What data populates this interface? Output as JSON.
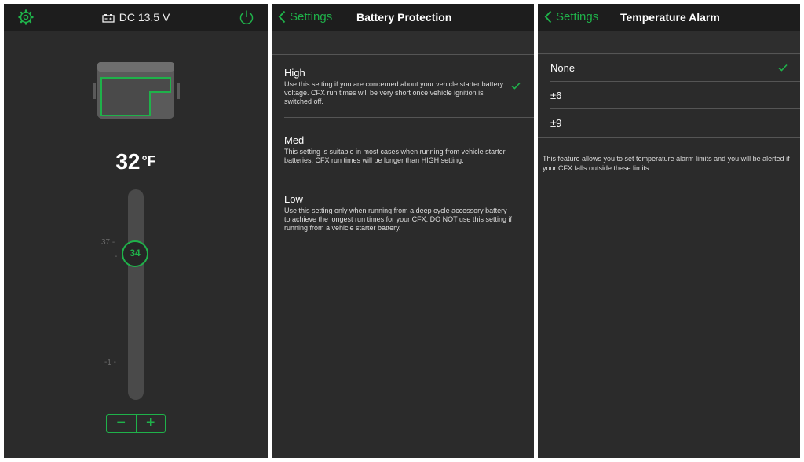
{
  "colors": {
    "accent": "#1fb24a",
    "panel_bg": "#2b2b2b",
    "bar_bg": "#1d1d1d"
  },
  "main": {
    "status": "DC 13.5 V",
    "temperature": "32",
    "unit": "°F",
    "setpoint": "34",
    "scale_top": "37",
    "scale_bottom": "-1",
    "minus": "−",
    "plus": "+"
  },
  "battery": {
    "back": "Settings",
    "title": "Battery Protection",
    "options": [
      {
        "name": "High",
        "desc": "Use this setting if you are concerned about your vehicle starter battery voltage. CFX run times will be very short once vehicle ignition is switched off."
      },
      {
        "name": "Med",
        "desc": "This setting is suitable in most cases when running from vehicle starter batteries. CFX run times will be longer than HIGH setting."
      },
      {
        "name": "Low",
        "desc": "Use this setting only when running from a deep cycle accessory battery to achieve the longest run times for your CFX. DO NOT use this setting if running from a vehicle starter battery."
      }
    ]
  },
  "alarm": {
    "back": "Settings",
    "title": "Temperature Alarm",
    "options": [
      "None",
      "±6",
      "±9"
    ],
    "note": "This feature allows you to set temperature alarm limits and you will be alerted if your CFX falls outside these limits."
  }
}
